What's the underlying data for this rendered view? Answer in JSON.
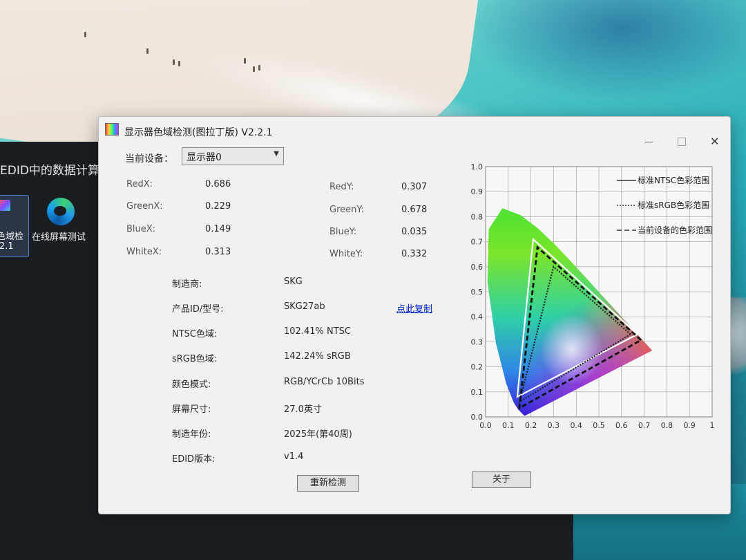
{
  "desktop": {
    "app_header_text": "EDID中的数据计算",
    "tile1_line1": "色域检",
    "tile1_line2": "2.1",
    "tile2_label": "在线屏幕测试"
  },
  "window": {
    "title": "显示器色域检测(图拉丁版) V2.2.1",
    "device_label": "当前设备：",
    "device_value": "显示器0",
    "coords": [
      {
        "label": "RedX:",
        "value": "0.686"
      },
      {
        "label": "GreenX:",
        "value": "0.229"
      },
      {
        "label": "BlueX:",
        "value": "0.149"
      },
      {
        "label": "WhiteX:",
        "value": "0.313"
      },
      {
        "label": "RedY:",
        "value": "0.307"
      },
      {
        "label": "GreenY:",
        "value": "0.678"
      },
      {
        "label": "BlueY:",
        "value": "0.035"
      },
      {
        "label": "WhiteY:",
        "value": "0.332"
      }
    ],
    "info": [
      {
        "label": "制造商:",
        "value": "SKG"
      },
      {
        "label": "产品ID/型号:",
        "value": "SKG27ab"
      },
      {
        "label": "NTSC色域:",
        "value": "102.41% NTSC"
      },
      {
        "label": "sRGB色域:",
        "value": "142.24% sRGB"
      },
      {
        "label": "颜色模式:",
        "value": "RGB/YCrCb 10Bits"
      },
      {
        "label": "屏幕尺寸:",
        "value": "27.0英寸"
      },
      {
        "label": "制造年份:",
        "value": "2025年(第40周)"
      },
      {
        "label": "EDID版本:",
        "value": "v1.4"
      }
    ],
    "copy_link": "点此复制",
    "redetect_button": "重新检测",
    "about_button": "关于"
  },
  "chart_data": {
    "type": "scatter",
    "title": "",
    "xlabel": "",
    "ylabel": "",
    "xlim": [
      0,
      1
    ],
    "ylim": [
      0,
      1
    ],
    "x_ticks": [
      "0.0",
      "0.1",
      "0.2",
      "0.3",
      "0.4",
      "0.5",
      "0.6",
      "0.7",
      "0.8",
      "0.9",
      "1"
    ],
    "y_ticks": [
      "0.0",
      "0.1",
      "0.2",
      "0.3",
      "0.4",
      "0.5",
      "0.6",
      "0.7",
      "0.8",
      "0.9",
      "1.0"
    ],
    "grid": true,
    "legend_position": "top-right",
    "series": [
      {
        "name": "标准NTSC色彩范围",
        "style": "solid",
        "color": "#ffffff",
        "points": [
          [
            0.67,
            0.33
          ],
          [
            0.21,
            0.71
          ],
          [
            0.14,
            0.08
          ],
          [
            0.67,
            0.33
          ]
        ]
      },
      {
        "name": "标准sRGB色彩范围",
        "style": "dotted",
        "color": "#222222",
        "points": [
          [
            0.64,
            0.33
          ],
          [
            0.3,
            0.6
          ],
          [
            0.15,
            0.06
          ],
          [
            0.64,
            0.33
          ]
        ]
      },
      {
        "name": "当前设备的色彩范围",
        "style": "dashed",
        "color": "#111111",
        "points": [
          [
            0.686,
            0.307
          ],
          [
            0.229,
            0.678
          ],
          [
            0.149,
            0.035
          ],
          [
            0.686,
            0.307
          ]
        ]
      }
    ]
  }
}
